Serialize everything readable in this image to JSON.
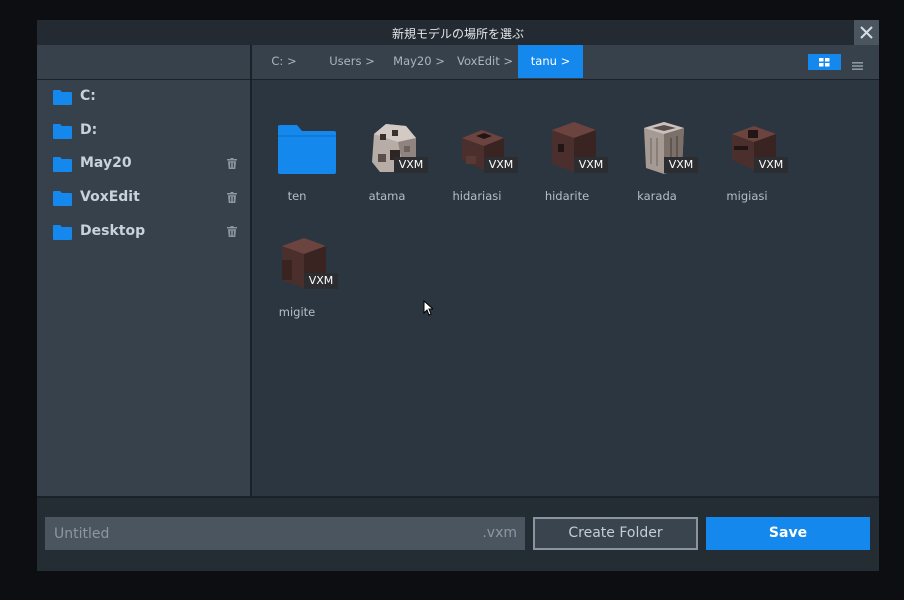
{
  "window": {
    "title": "新規モデルの場所を選ぶ"
  },
  "breadcrumbs": [
    {
      "label": "C: >"
    },
    {
      "label": "Users >"
    },
    {
      "label": "May20 >"
    },
    {
      "label": "VoxEdit >"
    },
    {
      "label": "tanu >",
      "active": true
    }
  ],
  "view_mode": "grid",
  "sidebar": {
    "items": [
      {
        "label": "C:",
        "icon": "folder-icon",
        "removable": false
      },
      {
        "label": "D:",
        "icon": "folder-icon",
        "removable": false
      },
      {
        "label": "May20",
        "icon": "folder-icon",
        "removable": true
      },
      {
        "label": "VoxEdit",
        "icon": "folder-icon",
        "removable": true
      },
      {
        "label": "Desktop",
        "icon": "folder-icon",
        "removable": true
      }
    ]
  },
  "files": [
    {
      "name": "ten",
      "type": "folder"
    },
    {
      "name": "atama",
      "type": "model",
      "badge": "VXM"
    },
    {
      "name": "hidariasi",
      "type": "model",
      "badge": "VXM"
    },
    {
      "name": "hidarite",
      "type": "model",
      "badge": "VXM"
    },
    {
      "name": "karada",
      "type": "model",
      "badge": "VXM"
    },
    {
      "name": "migiasi",
      "type": "model",
      "badge": "VXM"
    },
    {
      "name": "migite",
      "type": "model",
      "badge": "VXM"
    }
  ],
  "footer": {
    "filename_placeholder": "Untitled",
    "extension": ".vxm",
    "create_folder_label": "Create Folder",
    "save_label": "Save"
  },
  "colors": {
    "accent": "#1488ec",
    "folder": "#1488ec",
    "background": "#2c3640",
    "panel": "#36414b"
  }
}
